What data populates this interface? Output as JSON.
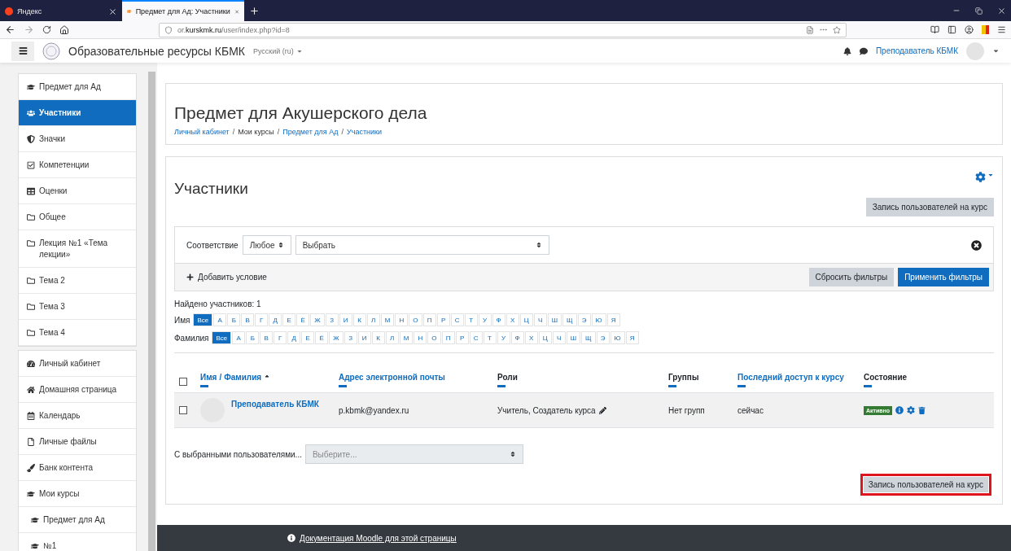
{
  "browser": {
    "tabs": [
      {
        "title": "Яндекс",
        "selected": false,
        "kind": "yandex"
      },
      {
        "title": "Предмет для Ад: Участники",
        "selected": true,
        "kind": "moodle"
      }
    ],
    "url": {
      "prefix": "or.",
      "host": "kurskmk.ru",
      "path": "/user/index.php?id=8"
    }
  },
  "navbar": {
    "site_name": "Образовательные ресурсы КБМК",
    "language": "Русский (ru)",
    "user_name": "Преподаватель КБМК"
  },
  "sidebar": {
    "sections": [
      [
        {
          "label": "Предмет для Ад",
          "kind": "course",
          "selected": false
        },
        {
          "label": "Участники",
          "kind": "users",
          "selected": true
        },
        {
          "label": "Значки",
          "kind": "shield",
          "selected": false
        },
        {
          "label": "Компетенции",
          "kind": "check",
          "selected": false
        },
        {
          "label": "Оценки",
          "kind": "table",
          "selected": false
        },
        {
          "label": "Общее",
          "kind": "folder",
          "selected": false
        },
        {
          "label": "Лекция №1 «Тема лекции»",
          "kind": "folder",
          "selected": false
        },
        {
          "label": "Тема 2",
          "kind": "folder",
          "selected": false
        },
        {
          "label": "Тема 3",
          "kind": "folder",
          "selected": false
        },
        {
          "label": "Тема 4",
          "kind": "folder",
          "selected": false
        }
      ],
      [
        {
          "label": "Личный кабинет",
          "kind": "dashboard",
          "selected": false
        },
        {
          "label": "Домашняя страница",
          "kind": "home",
          "selected": false
        },
        {
          "label": "Календарь",
          "kind": "calendar",
          "selected": false
        },
        {
          "label": "Личные файлы",
          "kind": "file",
          "selected": false
        },
        {
          "label": "Банк контента",
          "kind": "brush",
          "selected": false
        },
        {
          "label": "Мои курсы",
          "kind": "course",
          "selected": false,
          "children": [
            {
              "label": "Предмет для Ад",
              "kind": "course",
              "selected": false
            },
            {
              "label": "№1",
              "kind": "course",
              "selected": false
            }
          ]
        }
      ]
    ]
  },
  "header": {
    "title": "Предмет для Акушерского дела",
    "separator": "/",
    "breadcrumbs": [
      {
        "label": "Личный кабинет",
        "link": true
      },
      {
        "label": "Мои курсы",
        "link": false
      },
      {
        "label": "Предмет для Ад",
        "link": true
      },
      {
        "label": "Участники",
        "link": true
      }
    ]
  },
  "participants": {
    "title": "Участники",
    "enrol_button": "Запись пользователей на курс",
    "filter": {
      "match_label": "Соответствие",
      "match_value": "Любое",
      "select_placeholder": "Выбрать",
      "add_condition": "Добавить условие",
      "reset_button": "Сбросить фильтры",
      "apply_button": "Применить фильтры"
    },
    "found": "Найдено участников: 1",
    "initials": [
      {
        "label": "Имя",
        "letters": [
          {
            "text": "Все",
            "selected": true
          },
          {
            "text": "А",
            "selected": false
          },
          {
            "text": "Б",
            "selected": false
          },
          {
            "text": "В",
            "selected": false
          },
          {
            "text": "Г",
            "selected": false
          },
          {
            "text": "Д",
            "selected": false
          },
          {
            "text": "Е",
            "selected": false
          },
          {
            "text": "Ё",
            "selected": false
          },
          {
            "text": "Ж",
            "selected": false
          },
          {
            "text": "З",
            "selected": false
          },
          {
            "text": "И",
            "selected": false
          },
          {
            "text": "К",
            "selected": false
          },
          {
            "text": "Л",
            "selected": false
          },
          {
            "text": "М",
            "selected": false
          },
          {
            "text": "Н",
            "selected": false
          },
          {
            "text": "О",
            "selected": false
          },
          {
            "text": "П",
            "selected": false
          },
          {
            "text": "Р",
            "selected": false
          },
          {
            "text": "С",
            "selected": false
          },
          {
            "text": "Т",
            "selected": false
          },
          {
            "text": "У",
            "selected": false
          },
          {
            "text": "Ф",
            "selected": false
          },
          {
            "text": "Х",
            "selected": false
          },
          {
            "text": "Ц",
            "selected": false
          },
          {
            "text": "Ч",
            "selected": false
          },
          {
            "text": "Ш",
            "selected": false
          },
          {
            "text": "Щ",
            "selected": false
          },
          {
            "text": "Э",
            "selected": false
          },
          {
            "text": "Ю",
            "selected": false
          },
          {
            "text": "Я",
            "selected": false
          }
        ]
      },
      {
        "label": "Фамилия",
        "letters": [
          {
            "text": "Все",
            "selected": true
          },
          {
            "text": "А",
            "selected": false
          },
          {
            "text": "Б",
            "selected": false
          },
          {
            "text": "В",
            "selected": false
          },
          {
            "text": "Г",
            "selected": false
          },
          {
            "text": "Д",
            "selected": false
          },
          {
            "text": "Е",
            "selected": false
          },
          {
            "text": "Ё",
            "selected": false
          },
          {
            "text": "Ж",
            "selected": false
          },
          {
            "text": "З",
            "selected": false
          },
          {
            "text": "И",
            "selected": false
          },
          {
            "text": "К",
            "selected": false
          },
          {
            "text": "Л",
            "selected": false
          },
          {
            "text": "М",
            "selected": false
          },
          {
            "text": "Н",
            "selected": false
          },
          {
            "text": "О",
            "selected": false
          },
          {
            "text": "П",
            "selected": false
          },
          {
            "text": "Р",
            "selected": false
          },
          {
            "text": "С",
            "selected": false
          },
          {
            "text": "Т",
            "selected": false
          },
          {
            "text": "У",
            "selected": false
          },
          {
            "text": "Ф",
            "selected": false
          },
          {
            "text": "Х",
            "selected": false
          },
          {
            "text": "Ц",
            "selected": false
          },
          {
            "text": "Ч",
            "selected": false
          },
          {
            "text": "Ш",
            "selected": false
          },
          {
            "text": "Щ",
            "selected": false
          },
          {
            "text": "Э",
            "selected": false
          },
          {
            "text": "Ю",
            "selected": false
          },
          {
            "text": "Я",
            "selected": false
          }
        ]
      }
    ],
    "table": {
      "select_all_checked": false,
      "name_column": {
        "first": "Имя",
        "separator": "/",
        "last": "Фамилия"
      },
      "columns": [
        {
          "label": "Адрес электронной почты",
          "link": true
        },
        {
          "label": "Роли",
          "link": false
        },
        {
          "label": "Группы",
          "link": false
        },
        {
          "label": "Последний доступ к курсу",
          "link": true
        },
        {
          "label": "Состояние",
          "link": false
        }
      ],
      "rows": [
        {
          "checked": false,
          "name": "Преподаватель КБМК",
          "email": "p.kbmk@yandex.ru",
          "roles": "Учитель, Создатель курса",
          "groups": "Нет групп",
          "last_access": "сейчас",
          "status": "Активно"
        }
      ]
    },
    "bulk": {
      "label": "С выбранными пользователями...",
      "placeholder": "Выберите..."
    },
    "bottom_enrol_button": {
      "label": "Запись пользователей на курс",
      "highlighted": true
    }
  },
  "footer": {
    "doc_link": "Документация Moodle для этой страницы"
  }
}
